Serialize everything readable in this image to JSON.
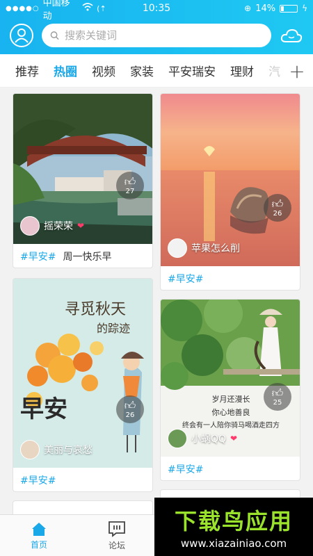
{
  "status": {
    "carrier": "中国移动",
    "time": "10:35",
    "battery": "14%"
  },
  "search": {
    "placeholder": "搜索关键词"
  },
  "tabs": [
    "推荐",
    "热圈",
    "视频",
    "家装",
    "平安瑞安",
    "理财",
    "汽"
  ],
  "active_tab": "热圈",
  "cards": [
    {
      "user": "摇荣荣",
      "likes": "27",
      "tag": "#早安#",
      "caption": "周一快乐早"
    },
    {
      "user": "苹果怎么削",
      "likes": "26",
      "tag": "#早安#",
      "caption": ""
    },
    {
      "user": "美丽与哀愁",
      "likes": "26",
      "tag": "#早安#",
      "caption": "",
      "art_title_1": "寻觅秋天",
      "art_title_2": "的踪迹",
      "art_big": "早安"
    },
    {
      "user": "小蜗QQ",
      "likes": "25",
      "tag": "#早安#",
      "caption": "",
      "poem_1": "岁月还漫长",
      "poem_2": "你心地善良",
      "poem_3": "终会有一人陪你骑马喝酒走四方"
    }
  ],
  "nav": {
    "home": "首页",
    "forum": "论坛"
  },
  "watermark": {
    "title": "下载鸟应用",
    "url": "www.xiazainiao.com"
  },
  "colors": {
    "accent": "#1ba8e8",
    "header": "#18b3f0"
  }
}
